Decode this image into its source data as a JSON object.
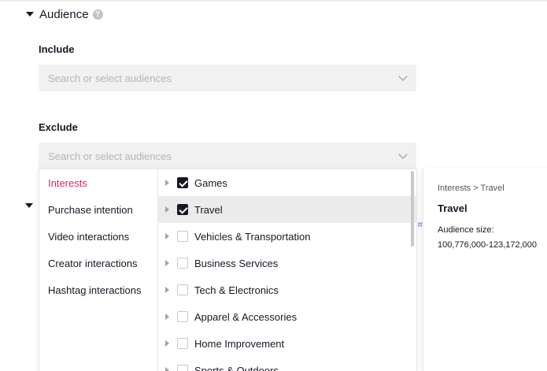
{
  "audience": {
    "title": "Audience",
    "help_icon": "?"
  },
  "include": {
    "label": "Include",
    "placeholder": "Search or select audiences"
  },
  "exclude": {
    "label": "Exclude",
    "placeholder": "Search or select audiences"
  },
  "hidden_link_fragment": "m",
  "dropdown": {
    "categories": [
      {
        "label": "Interests",
        "active": true
      },
      {
        "label": "Purchase intention",
        "active": false
      },
      {
        "label": "Video interactions",
        "active": false
      },
      {
        "label": "Creator interactions",
        "active": false
      },
      {
        "label": "Hashtag interactions",
        "active": false
      }
    ],
    "options": [
      {
        "label": "Games",
        "checked": true
      },
      {
        "label": "Travel",
        "checked": true
      },
      {
        "label": "Vehicles & Transportation",
        "checked": false
      },
      {
        "label": "Business Services",
        "checked": false
      },
      {
        "label": "Tech & Electronics",
        "checked": false
      },
      {
        "label": "Apparel & Accessories",
        "checked": false
      },
      {
        "label": "Home Improvement",
        "checked": false
      },
      {
        "label": "Sports & Outdoors",
        "checked": false
      }
    ]
  },
  "detail": {
    "path": "Interests > Travel",
    "title": "Travel",
    "size_label": "Audience size:",
    "size_value": "100,776,000-123,172,000"
  },
  "colors": {
    "accent": "#e0245e",
    "checkbox_checked": "#161823",
    "field_bg": "#f1f1f2"
  }
}
